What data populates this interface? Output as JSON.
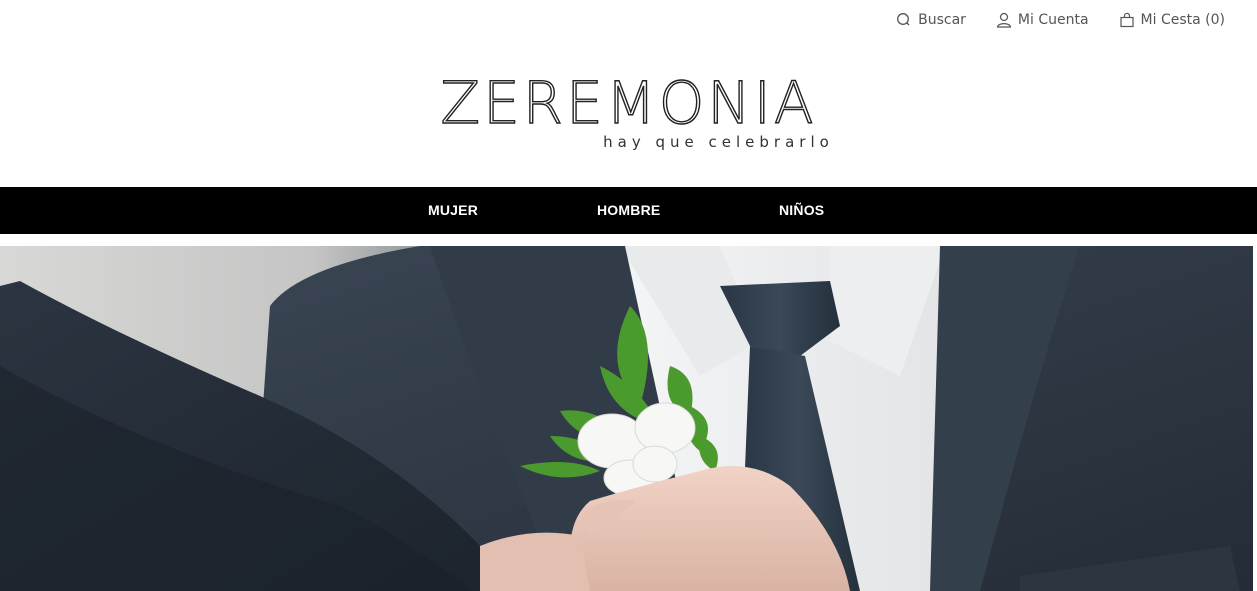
{
  "header": {
    "links": {
      "search": "Buscar",
      "account": "Mi Cuenta",
      "cart": "Mi Cesta (0)"
    }
  },
  "logo": {
    "brand": "ZEREMONIA",
    "tagline": "hay que celebrarlo"
  },
  "nav": {
    "items": [
      "MUJER",
      "HOMBRE",
      "NIÑOS"
    ]
  },
  "hero": {
    "image": "groom-boutonniere-photo"
  },
  "colors": {
    "navbar": "#000000",
    "background": "#ffffff",
    "suit": "#2f3a47"
  }
}
